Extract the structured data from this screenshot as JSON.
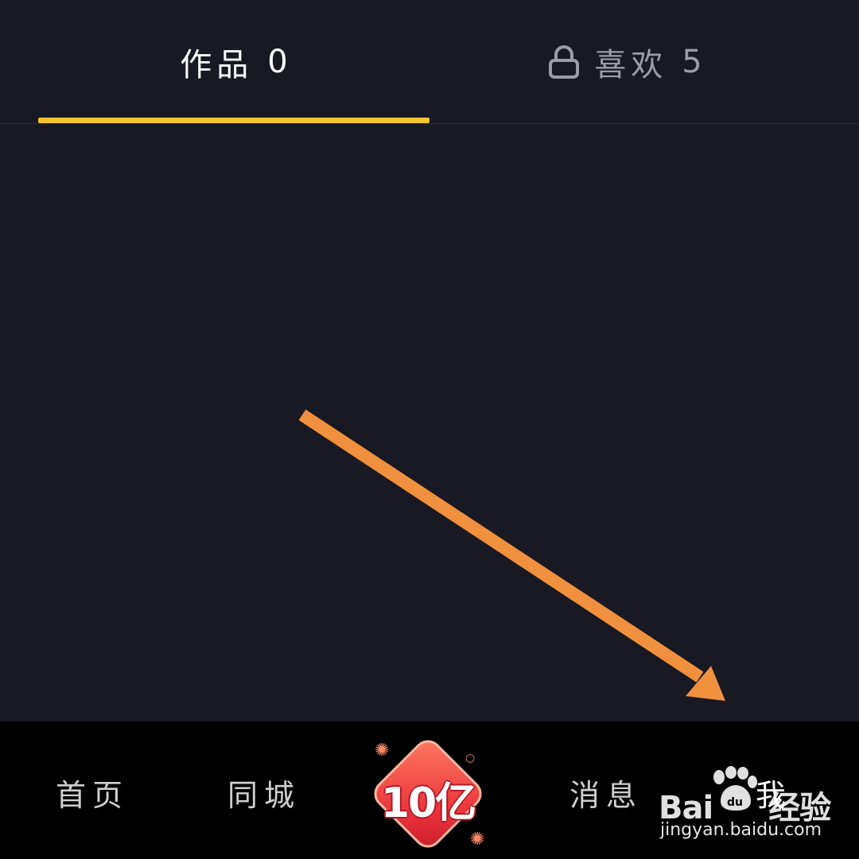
{
  "tabs": {
    "works": {
      "label": "作品",
      "count": "0"
    },
    "likes": {
      "label": "喜欢",
      "count": "5",
      "icon": "lock-icon"
    },
    "indicator_color": "#f5c531"
  },
  "annotation": {
    "color": "#f0903f"
  },
  "bottom_nav": {
    "items": [
      {
        "label": "首页"
      },
      {
        "label": "同城"
      },
      {
        "label": "消息"
      },
      {
        "label": "我"
      }
    ],
    "promo_label": "10亿"
  },
  "watermark": {
    "logo": "Bai",
    "logo_suffix": "经验",
    "url": "jingyan.baidu.com"
  }
}
